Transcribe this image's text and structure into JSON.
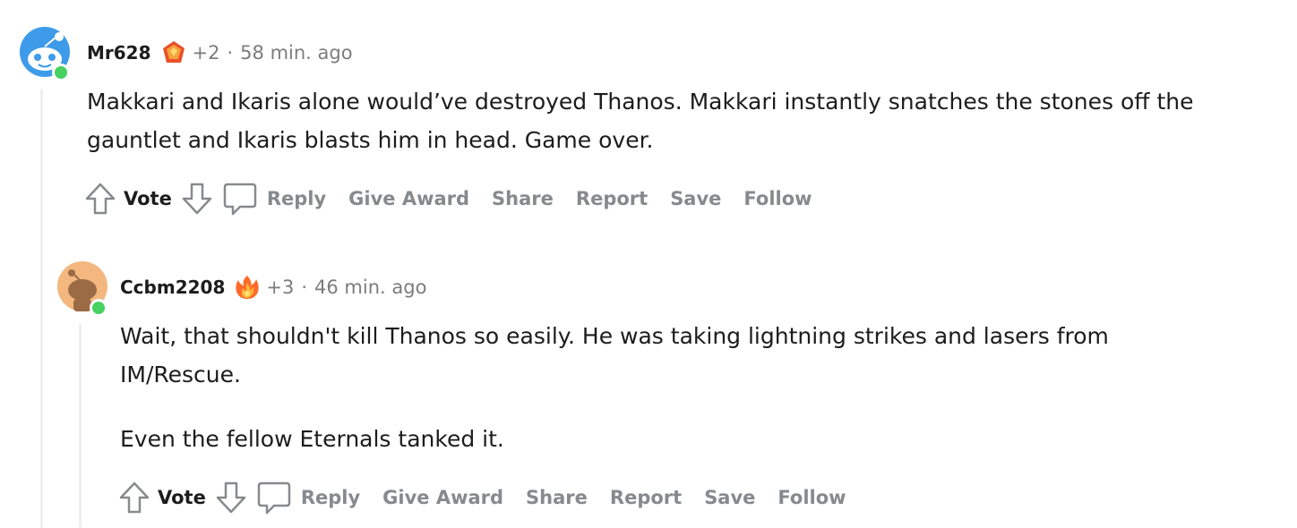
{
  "comments": [
    {
      "username": "Mr628",
      "points": "+2",
      "separator": "·",
      "time": "58 min. ago",
      "body": [
        "Makkari and Ikaris alone would’ve destroyed Thanos. Makkari instantly snatches the stones off the gauntlet and Ikaris blasts him in head. Game over."
      ],
      "avatar_color": "#3d9be9",
      "award_icon": "red-gem-award-icon"
    },
    {
      "username": "Ccbm2208",
      "points": "+3",
      "separator": "·",
      "time": "46 min. ago",
      "body": [
        "Wait, that shouldn't kill Thanos so easily. He was taking lightning strikes and lasers from IM/Rescue.",
        "Even the fellow Eternals tanked it."
      ],
      "avatar_color": "#f3b77f",
      "award_icon": "fire-award-icon"
    }
  ],
  "actions": {
    "vote": "Vote",
    "reply": "Reply",
    "give_award": "Give Award",
    "share": "Share",
    "report": "Report",
    "save": "Save",
    "follow": "Follow"
  },
  "colors": {
    "online": "#46d160",
    "meta_gray": "#7c7c7c",
    "action_gray": "#878a8c",
    "thread_line": "#edeff1"
  }
}
